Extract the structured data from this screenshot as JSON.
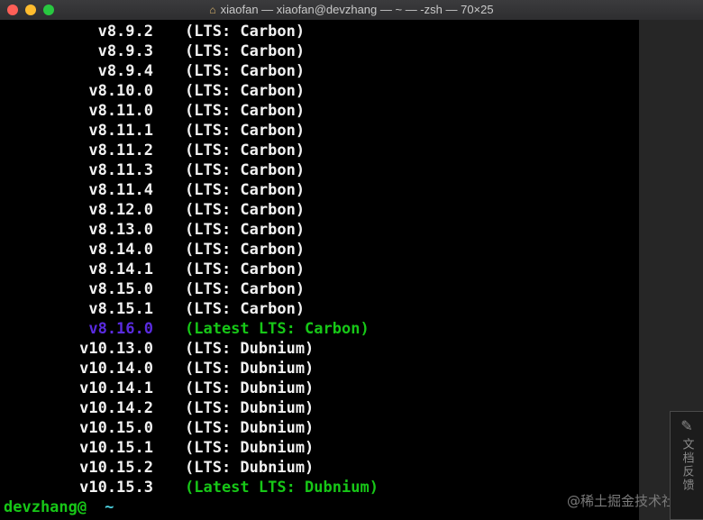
{
  "window": {
    "title": "xiaofan — xiaofan@devzhang — ~ — -zsh — 70×25",
    "home_icon": "home-icon"
  },
  "colors": {
    "default": "#f2f2f2",
    "current": "#5a2be0",
    "latest": "#17c717",
    "prompt": "#17c717",
    "tilde": "#4dd2e0"
  },
  "lines": [
    {
      "version": "v8.9.2",
      "label": "(LTS: Carbon)",
      "style": "default"
    },
    {
      "version": "v8.9.3",
      "label": "(LTS: Carbon)",
      "style": "default"
    },
    {
      "version": "v8.9.4",
      "label": "(LTS: Carbon)",
      "style": "default"
    },
    {
      "version": "v8.10.0",
      "label": "(LTS: Carbon)",
      "style": "default"
    },
    {
      "version": "v8.11.0",
      "label": "(LTS: Carbon)",
      "style": "default"
    },
    {
      "version": "v8.11.1",
      "label": "(LTS: Carbon)",
      "style": "default"
    },
    {
      "version": "v8.11.2",
      "label": "(LTS: Carbon)",
      "style": "default"
    },
    {
      "version": "v8.11.3",
      "label": "(LTS: Carbon)",
      "style": "default"
    },
    {
      "version": "v8.11.4",
      "label": "(LTS: Carbon)",
      "style": "default"
    },
    {
      "version": "v8.12.0",
      "label": "(LTS: Carbon)",
      "style": "default"
    },
    {
      "version": "v8.13.0",
      "label": "(LTS: Carbon)",
      "style": "default"
    },
    {
      "version": "v8.14.0",
      "label": "(LTS: Carbon)",
      "style": "default"
    },
    {
      "version": "v8.14.1",
      "label": "(LTS: Carbon)",
      "style": "default"
    },
    {
      "version": "v8.15.0",
      "label": "(LTS: Carbon)",
      "style": "default"
    },
    {
      "version": "v8.15.1",
      "label": "(LTS: Carbon)",
      "style": "default"
    },
    {
      "version": "v8.16.0",
      "label": "(Latest LTS: Carbon)",
      "style": "current"
    },
    {
      "version": "v10.13.0",
      "label": "(LTS: Dubnium)",
      "style": "default"
    },
    {
      "version": "v10.14.0",
      "label": "(LTS: Dubnium)",
      "style": "default"
    },
    {
      "version": "v10.14.1",
      "label": "(LTS: Dubnium)",
      "style": "default"
    },
    {
      "version": "v10.14.2",
      "label": "(LTS: Dubnium)",
      "style": "default"
    },
    {
      "version": "v10.15.0",
      "label": "(LTS: Dubnium)",
      "style": "default"
    },
    {
      "version": "v10.15.1",
      "label": "(LTS: Dubnium)",
      "style": "default"
    },
    {
      "version": "v10.15.2",
      "label": "(LTS: Dubnium)",
      "style": "default"
    },
    {
      "version": "v10.15.3",
      "label": "(Latest LTS: Dubnium)",
      "style": "latest"
    }
  ],
  "prompt": {
    "user_host": "devzhang@",
    "cwd": "~"
  },
  "watermark": "@稀土掘金技术社区",
  "side_tab": {
    "icon": "edit-icon",
    "label": "文档反馈"
  }
}
